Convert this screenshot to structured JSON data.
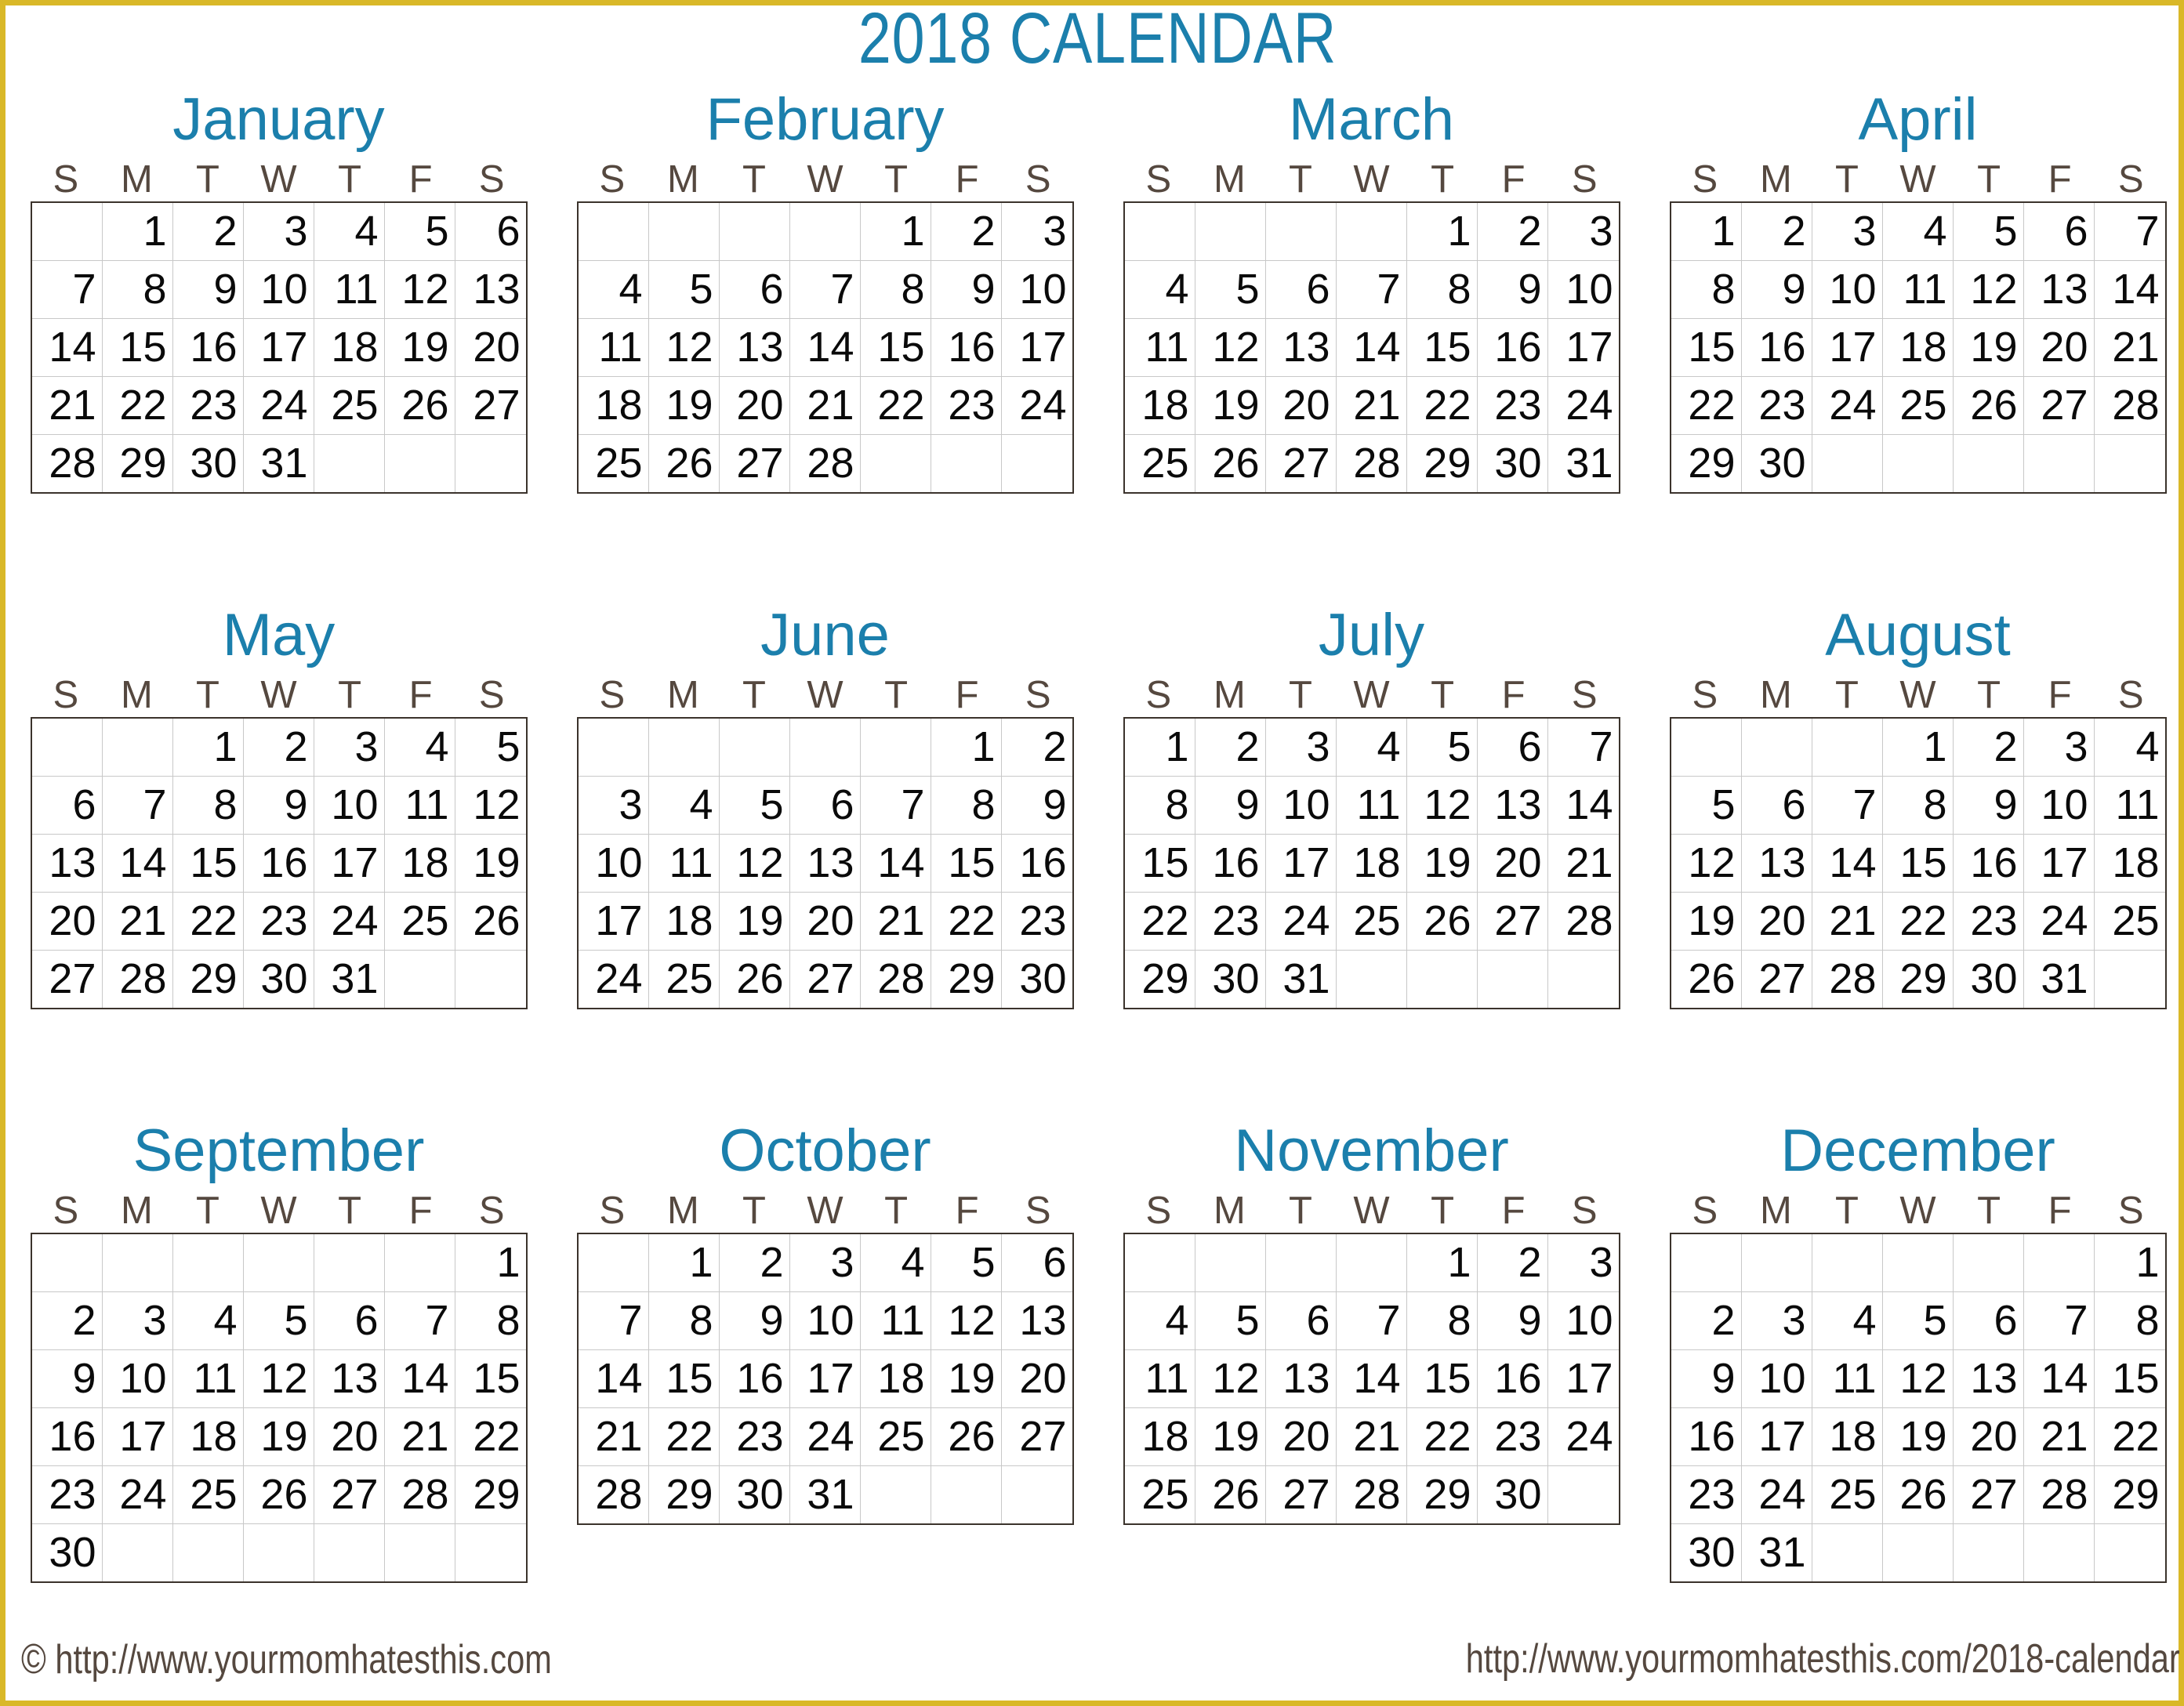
{
  "title": "2018 CALENDAR",
  "year": "2018",
  "colors": {
    "accent": "#1B7FAC",
    "border": "#D9B828",
    "dow_text": "#55483F",
    "day_text": "#0A0A0A",
    "grid_outer": "#3B332C",
    "grid_inner": "#C8C8C8"
  },
  "day_headers": [
    "S",
    "M",
    "T",
    "W",
    "T",
    "F",
    "S"
  ],
  "footer": {
    "copyright_icon": "©",
    "left": "http://www.yourmomhatesthis.com",
    "right": "http://www.yourmomhatesthis.com/2018-calendar"
  },
  "months": [
    {
      "name": "January",
      "weeks": [
        [
          "",
          "1",
          "2",
          "3",
          "4",
          "5",
          "6"
        ],
        [
          "7",
          "8",
          "9",
          "10",
          "11",
          "12",
          "13"
        ],
        [
          "14",
          "15",
          "16",
          "17",
          "18",
          "19",
          "20"
        ],
        [
          "21",
          "22",
          "23",
          "24",
          "25",
          "26",
          "27"
        ],
        [
          "28",
          "29",
          "30",
          "31",
          "",
          "",
          ""
        ]
      ]
    },
    {
      "name": "February",
      "weeks": [
        [
          "",
          "",
          "",
          "",
          "1",
          "2",
          "3"
        ],
        [
          "4",
          "5",
          "6",
          "7",
          "8",
          "9",
          "10"
        ],
        [
          "11",
          "12",
          "13",
          "14",
          "15",
          "16",
          "17"
        ],
        [
          "18",
          "19",
          "20",
          "21",
          "22",
          "23",
          "24"
        ],
        [
          "25",
          "26",
          "27",
          "28",
          "",
          "",
          ""
        ]
      ]
    },
    {
      "name": "March",
      "weeks": [
        [
          "",
          "",
          "",
          "",
          "1",
          "2",
          "3"
        ],
        [
          "4",
          "5",
          "6",
          "7",
          "8",
          "9",
          "10"
        ],
        [
          "11",
          "12",
          "13",
          "14",
          "15",
          "16",
          "17"
        ],
        [
          "18",
          "19",
          "20",
          "21",
          "22",
          "23",
          "24"
        ],
        [
          "25",
          "26",
          "27",
          "28",
          "29",
          "30",
          "31"
        ]
      ]
    },
    {
      "name": "April",
      "weeks": [
        [
          "1",
          "2",
          "3",
          "4",
          "5",
          "6",
          "7"
        ],
        [
          "8",
          "9",
          "10",
          "11",
          "12",
          "13",
          "14"
        ],
        [
          "15",
          "16",
          "17",
          "18",
          "19",
          "20",
          "21"
        ],
        [
          "22",
          "23",
          "24",
          "25",
          "26",
          "27",
          "28"
        ],
        [
          "29",
          "30",
          "",
          "",
          "",
          "",
          ""
        ]
      ]
    },
    {
      "name": "May",
      "weeks": [
        [
          "",
          "",
          "1",
          "2",
          "3",
          "4",
          "5"
        ],
        [
          "6",
          "7",
          "8",
          "9",
          "10",
          "11",
          "12"
        ],
        [
          "13",
          "14",
          "15",
          "16",
          "17",
          "18",
          "19"
        ],
        [
          "20",
          "21",
          "22",
          "23",
          "24",
          "25",
          "26"
        ],
        [
          "27",
          "28",
          "29",
          "30",
          "31",
          "",
          ""
        ]
      ]
    },
    {
      "name": "June",
      "weeks": [
        [
          "",
          "",
          "",
          "",
          "",
          "1",
          "2"
        ],
        [
          "3",
          "4",
          "5",
          "6",
          "7",
          "8",
          "9"
        ],
        [
          "10",
          "11",
          "12",
          "13",
          "14",
          "15",
          "16"
        ],
        [
          "17",
          "18",
          "19",
          "20",
          "21",
          "22",
          "23"
        ],
        [
          "24",
          "25",
          "26",
          "27",
          "28",
          "29",
          "30"
        ]
      ]
    },
    {
      "name": "July",
      "weeks": [
        [
          "1",
          "2",
          "3",
          "4",
          "5",
          "6",
          "7"
        ],
        [
          "8",
          "9",
          "10",
          "11",
          "12",
          "13",
          "14"
        ],
        [
          "15",
          "16",
          "17",
          "18",
          "19",
          "20",
          "21"
        ],
        [
          "22",
          "23",
          "24",
          "25",
          "26",
          "27",
          "28"
        ],
        [
          "29",
          "30",
          "31",
          "",
          "",
          "",
          ""
        ]
      ]
    },
    {
      "name": "August",
      "weeks": [
        [
          "",
          "",
          "",
          "1",
          "2",
          "3",
          "4"
        ],
        [
          "5",
          "6",
          "7",
          "8",
          "9",
          "10",
          "11"
        ],
        [
          "12",
          "13",
          "14",
          "15",
          "16",
          "17",
          "18"
        ],
        [
          "19",
          "20",
          "21",
          "22",
          "23",
          "24",
          "25"
        ],
        [
          "26",
          "27",
          "28",
          "29",
          "30",
          "31",
          ""
        ]
      ]
    },
    {
      "name": "September",
      "weeks": [
        [
          "",
          "",
          "",
          "",
          "",
          "",
          "1"
        ],
        [
          "2",
          "3",
          "4",
          "5",
          "6",
          "7",
          "8"
        ],
        [
          "9",
          "10",
          "11",
          "12",
          "13",
          "14",
          "15"
        ],
        [
          "16",
          "17",
          "18",
          "19",
          "20",
          "21",
          "22"
        ],
        [
          "23",
          "24",
          "25",
          "26",
          "27",
          "28",
          "29"
        ],
        [
          "30",
          "",
          "",
          "",
          "",
          "",
          ""
        ]
      ]
    },
    {
      "name": "October",
      "weeks": [
        [
          "",
          "1",
          "2",
          "3",
          "4",
          "5",
          "6"
        ],
        [
          "7",
          "8",
          "9",
          "10",
          "11",
          "12",
          "13"
        ],
        [
          "14",
          "15",
          "16",
          "17",
          "18",
          "19",
          "20"
        ],
        [
          "21",
          "22",
          "23",
          "24",
          "25",
          "26",
          "27"
        ],
        [
          "28",
          "29",
          "30",
          "31",
          "",
          "",
          ""
        ]
      ]
    },
    {
      "name": "November",
      "weeks": [
        [
          "",
          "",
          "",
          "",
          "1",
          "2",
          "3"
        ],
        [
          "4",
          "5",
          "6",
          "7",
          "8",
          "9",
          "10"
        ],
        [
          "11",
          "12",
          "13",
          "14",
          "15",
          "16",
          "17"
        ],
        [
          "18",
          "19",
          "20",
          "21",
          "22",
          "23",
          "24"
        ],
        [
          "25",
          "26",
          "27",
          "28",
          "29",
          "30",
          ""
        ]
      ]
    },
    {
      "name": "December",
      "weeks": [
        [
          "",
          "",
          "",
          "",
          "",
          "",
          "1"
        ],
        [
          "2",
          "3",
          "4",
          "5",
          "6",
          "7",
          "8"
        ],
        [
          "9",
          "10",
          "11",
          "12",
          "13",
          "14",
          "15"
        ],
        [
          "16",
          "17",
          "18",
          "19",
          "20",
          "21",
          "22"
        ],
        [
          "23",
          "24",
          "25",
          "26",
          "27",
          "28",
          "29"
        ],
        [
          "30",
          "31",
          "",
          "",
          "",
          "",
          ""
        ]
      ]
    }
  ]
}
